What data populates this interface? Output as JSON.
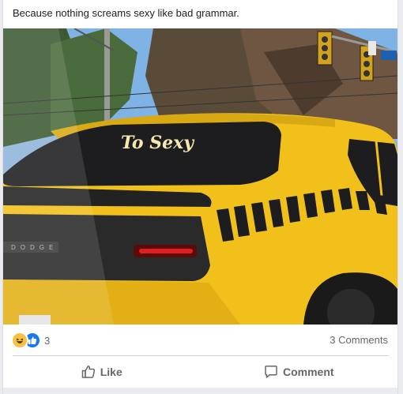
{
  "post": {
    "caption": "Because nothing screams sexy like bad grammar.",
    "image": {
      "windshield_text": "To Sexy",
      "brand_text": "DODGE",
      "colors": {
        "car_yellow": "#f2c01a",
        "window_dark": "#1d1d1f",
        "sky": "#7fb2e5",
        "taillight": "#e02020"
      }
    },
    "reactions": {
      "icons": [
        "haha-icon",
        "like-icon"
      ],
      "count": "3"
    },
    "comments_count": "3 Comments",
    "actions": {
      "like_label": "Like",
      "comment_label": "Comment"
    }
  }
}
